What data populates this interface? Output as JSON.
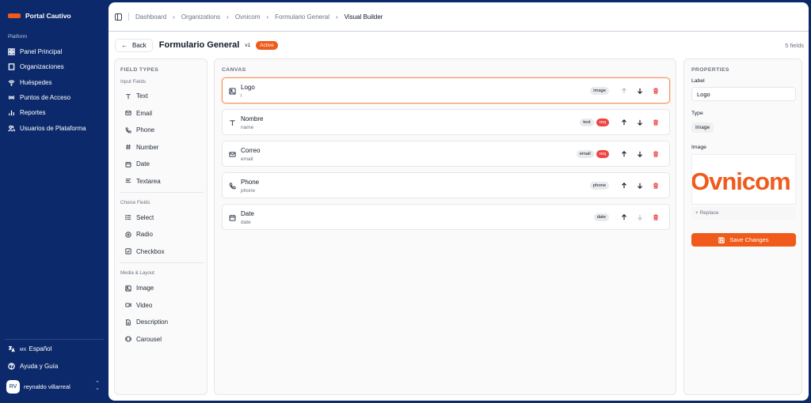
{
  "app": {
    "name": "Portal Cautivo",
    "brand_color": "#f05a1a",
    "sidebar_color": "#0c2a6b"
  },
  "sidebar": {
    "section_label": "Platform",
    "items": [
      {
        "label": "Panel Principal",
        "icon": "grid-icon"
      },
      {
        "label": "Organizaciones",
        "icon": "building-icon"
      },
      {
        "label": "Huéspedes",
        "icon": "wifi-icon"
      },
      {
        "label": "Puntos de Acceso",
        "icon": "access-point-icon"
      },
      {
        "label": "Reportes",
        "icon": "bar-chart-icon"
      },
      {
        "label": "Usuarios de Plataforma",
        "icon": "users-icon"
      }
    ],
    "language": {
      "code": "MX",
      "label": "Español"
    },
    "help_label": "Ayuda y Guía",
    "user": {
      "initials": "RV",
      "name": "reynaldo villarreal"
    }
  },
  "breadcrumb": [
    "Dashboard",
    "Organizations",
    "Ovnicom",
    "Formulario General",
    "Visual Builder"
  ],
  "header": {
    "back_label": "Back",
    "title": "Formulario General",
    "version": "v1",
    "status": "Active",
    "field_count": "5 fields"
  },
  "field_types": {
    "title": "FIELD TYPES",
    "groups": [
      {
        "label": "Input Fields",
        "items": [
          "Text",
          "Email",
          "Phone",
          "Number",
          "Date",
          "Textarea"
        ]
      },
      {
        "label": "Choice Fields",
        "items": [
          "Select",
          "Radio",
          "Checkbox"
        ]
      },
      {
        "label": "Media & Layout",
        "items": [
          "Image",
          "Video",
          "Description",
          "Carousel"
        ]
      }
    ]
  },
  "canvas": {
    "title": "CANVAS",
    "fields": [
      {
        "label": "Logo",
        "key": "l",
        "type": "image",
        "required": false,
        "selected": true
      },
      {
        "label": "Nombre",
        "key": "name",
        "type": "text",
        "required": true,
        "required_label": "req"
      },
      {
        "label": "Correo",
        "key": "email",
        "type": "email",
        "required": true,
        "required_label": "req"
      },
      {
        "label": "Phone",
        "key": "phone",
        "type": "phone",
        "required": false
      },
      {
        "label": "Date",
        "key": "date",
        "type": "date",
        "required": false
      }
    ]
  },
  "properties": {
    "title": "PROPERTIES",
    "label_caption": "Label",
    "label_value": "Logo",
    "type_caption": "Type",
    "type_value": "Image",
    "image_caption": "Image",
    "image_logo_text": "Ovnicom",
    "replace_label": "+ Replace",
    "save_label": "Save Changes"
  }
}
